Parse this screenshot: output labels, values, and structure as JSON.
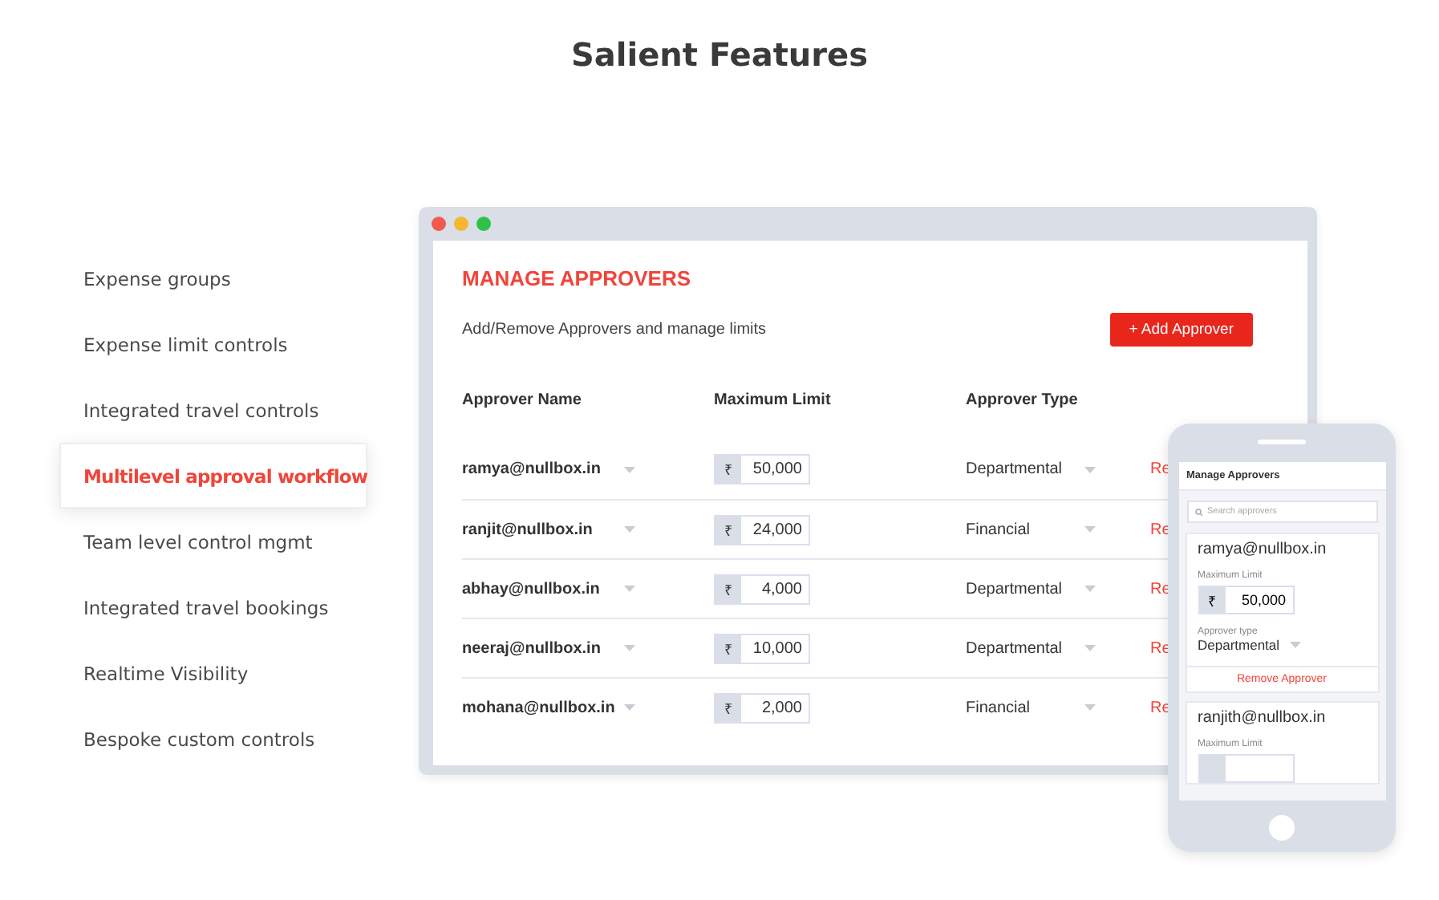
{
  "title": "Salient Features",
  "features": [
    {
      "label": "Expense groups",
      "selected": false
    },
    {
      "label": "Expense limit controls",
      "selected": false
    },
    {
      "label": "Integrated travel controls",
      "selected": false
    },
    {
      "label": "Multilevel approval workflow",
      "selected": true
    },
    {
      "label": "Team level control mgmt",
      "selected": false
    },
    {
      "label": "Integrated travel bookings",
      "selected": false
    },
    {
      "label": "Realtime Visibility",
      "selected": false
    },
    {
      "label": "Bespoke custom controls",
      "selected": false
    }
  ],
  "desktop": {
    "heading": "MANAGE APPROVERS",
    "subtitle": "Add/Remove Approvers and manage limits",
    "add_button": "+ Add Approver",
    "columns": [
      "Approver Name",
      "Maximum Limit",
      "Approver Type"
    ],
    "rows": [
      {
        "name": "ramya@nullbox.in",
        "currency": "₹",
        "limit": "50,000",
        "type": "Departmental",
        "action": "Re"
      },
      {
        "name": "ranjit@nullbox.in",
        "currency": "₹",
        "limit": "24,000",
        "type": "Financial",
        "action": "Re"
      },
      {
        "name": "abhay@nullbox.in",
        "currency": "₹",
        "limit": "4,000",
        "type": "Departmental",
        "action": "Re"
      },
      {
        "name": "neeraj@nullbox.in",
        "currency": "₹",
        "limit": "10,000",
        "type": "Departmental",
        "action": "Re"
      },
      {
        "name": "mohana@nullbox.in",
        "currency": "₹",
        "limit": "2,000",
        "type": "Financial",
        "action": "Re"
      }
    ]
  },
  "mobile": {
    "title": "Manage Approvers",
    "search": {
      "placeholder": "Search approvers"
    },
    "cards": [
      {
        "name": "ramya@nullbox.in",
        "limit_label": "Maximum Limit",
        "currency": "₹",
        "limit": "50,000",
        "type_label": "Approver type",
        "type": "Departmental",
        "remove": "Remove Approver"
      },
      {
        "name": "ranjith@nullbox.in",
        "limit_label": "Maximum Limit"
      }
    ]
  }
}
